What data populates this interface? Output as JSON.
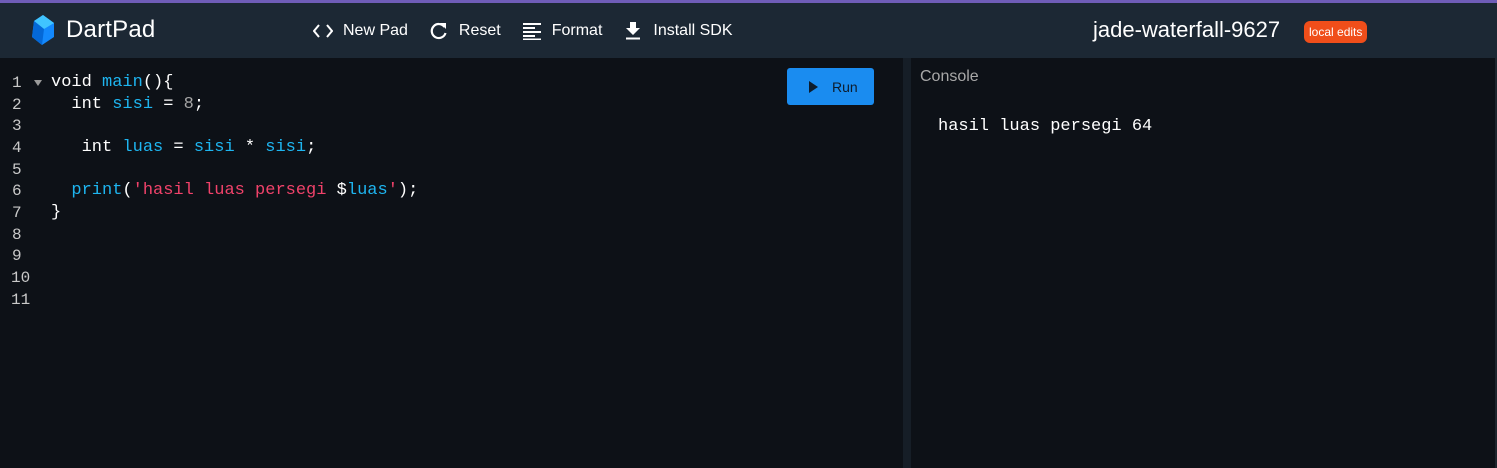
{
  "header": {
    "app_title": "DartPad",
    "toolbar": [
      {
        "id": "new-pad",
        "label": "New Pad",
        "icon": "code-icon"
      },
      {
        "id": "reset",
        "label": "Reset",
        "icon": "refresh-icon"
      },
      {
        "id": "format",
        "label": "Format",
        "icon": "format-align-icon"
      },
      {
        "id": "install-sdk",
        "label": "Install SDK",
        "icon": "download-icon"
      }
    ],
    "pad_name": "jade-waterfall-9627",
    "badge": "local edits",
    "colors": {
      "header_bg": "#1c2834",
      "badge_bg": "#f04e1a",
      "accent_line": "#6f5db8"
    }
  },
  "editor": {
    "line_numbers": [
      "1",
      "2",
      "3",
      "4",
      "5",
      "6",
      "7",
      "8",
      "9",
      "10",
      "11"
    ],
    "lines": [
      "void main(){",
      "  int sisi = 8;",
      "",
      "   int luas = sisi * sisi;",
      "",
      "  print('hasil luas persegi $luas');",
      "}",
      "",
      "",
      "",
      ""
    ],
    "run_button": "Run",
    "colors": {
      "run_bg": "#1a8cf0",
      "identifier": "#1eb5f0",
      "string": "#f0426a"
    }
  },
  "console": {
    "title": "Console",
    "output": "hasil luas persegi 64"
  }
}
